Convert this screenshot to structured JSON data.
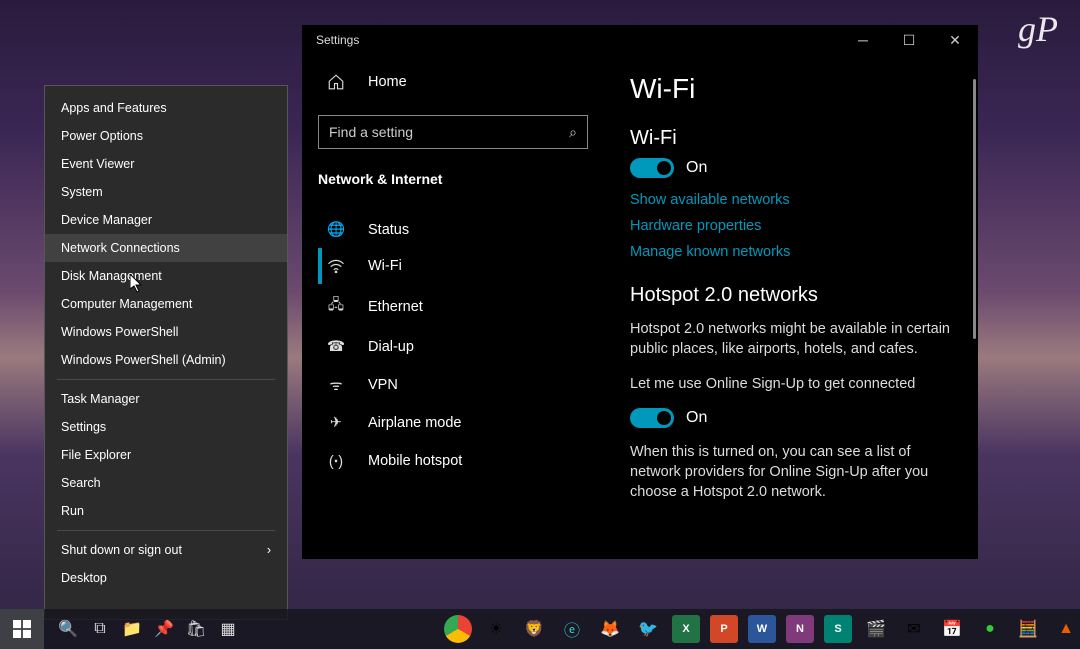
{
  "watermark": "gP",
  "winx": {
    "items": [
      {
        "label": "Apps and Features"
      },
      {
        "label": "Power Options"
      },
      {
        "label": "Event Viewer"
      },
      {
        "label": "System"
      },
      {
        "label": "Device Manager"
      },
      {
        "label": "Network Connections",
        "hover": true
      },
      {
        "label": "Disk Management"
      },
      {
        "label": "Computer Management"
      },
      {
        "label": "Windows PowerShell"
      },
      {
        "label": "Windows PowerShell (Admin)"
      }
    ],
    "items2": [
      {
        "label": "Task Manager"
      },
      {
        "label": "Settings"
      },
      {
        "label": "File Explorer"
      },
      {
        "label": "Search"
      },
      {
        "label": "Run"
      }
    ],
    "items3": [
      {
        "label": "Shut down or sign out",
        "chevron": true
      },
      {
        "label": "Desktop"
      }
    ]
  },
  "settings": {
    "title": "Settings",
    "home": "Home",
    "search_placeholder": "Find a setting",
    "section": "Network & Internet",
    "nav": [
      {
        "icon": "status",
        "label": "Status"
      },
      {
        "icon": "wifi",
        "label": "Wi-Fi",
        "selected": true
      },
      {
        "icon": "ethernet",
        "label": "Ethernet"
      },
      {
        "icon": "dialup",
        "label": "Dial-up"
      },
      {
        "icon": "vpn",
        "label": "VPN"
      },
      {
        "icon": "airplane",
        "label": "Airplane mode"
      },
      {
        "icon": "hotspot",
        "label": "Mobile hotspot"
      }
    ]
  },
  "pane": {
    "h1": "Wi-Fi",
    "wifi_label": "Wi-Fi",
    "toggle1": "On",
    "link1": "Show available networks",
    "link2": "Hardware properties",
    "link3": "Manage known networks",
    "h2": "Hotspot 2.0 networks",
    "p1": "Hotspot 2.0 networks might be available in certain public places, like airports, hotels, and cafes.",
    "p2": "Let me use Online Sign-Up to get connected",
    "toggle2": "On",
    "p3": "When this is turned on, you can see a list of network providers for Online Sign-Up after you choose a Hotspot 2.0 network."
  }
}
